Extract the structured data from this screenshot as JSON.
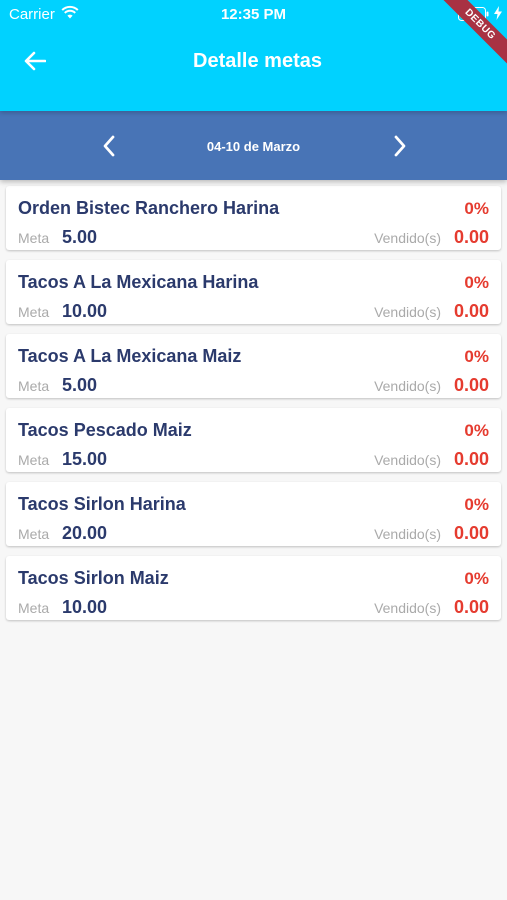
{
  "status_bar": {
    "carrier": "Carrier",
    "time": "12:35 PM"
  },
  "app_bar": {
    "title": "Detalle metas",
    "back_icon": "arrow-left-icon",
    "debug_banner": "DEBUG"
  },
  "week_selector": {
    "label": "04-10 de Marzo",
    "prev_icon": "chevron-left-icon",
    "next_icon": "chevron-right-icon"
  },
  "labels": {
    "meta": "Meta",
    "sold": "Vendido(s)"
  },
  "goals": [
    {
      "name": "Orden Bistec Ranchero Harina",
      "percent": "0%",
      "meta": "5.00",
      "sold": "0.00"
    },
    {
      "name": "Tacos A La Mexicana Harina",
      "percent": "0%",
      "meta": "10.00",
      "sold": "0.00"
    },
    {
      "name": "Tacos A La Mexicana Maiz",
      "percent": "0%",
      "meta": "5.00",
      "sold": "0.00"
    },
    {
      "name": "Tacos Pescado Maiz",
      "percent": "0%",
      "meta": "15.00",
      "sold": "0.00"
    },
    {
      "name": "Tacos Sirlon Harina",
      "percent": "0%",
      "meta": "20.00",
      "sold": "0.00"
    },
    {
      "name": "Tacos Sirlon Maiz",
      "percent": "0%",
      "meta": "10.00",
      "sold": "0.00"
    }
  ],
  "colors": {
    "app_bar": "#00d2ff",
    "week_bar": "#4874b6",
    "title_text": "#2b3a6c",
    "alert_red": "#e53b2f",
    "background": "#f7f7f7"
  }
}
